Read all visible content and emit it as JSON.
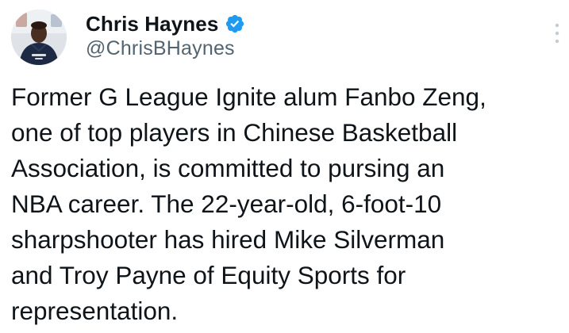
{
  "author": {
    "display_name": "Chris Haynes",
    "handle": "@ChrisBHaynes",
    "verified_icon": "verified-badge-icon",
    "avatar_icon": "profile-avatar"
  },
  "menu": {
    "more_icon": "more-vertical-icon"
  },
  "tweet": {
    "text": "Former G League Ignite alum Fanbo Zeng,\none of top players in Chinese Basketball\nAssociation, is committed to pursing an\nNBA career. The 22-year-old, 6-foot-10\nsharpshooter has hired Mike Silverman\nand Troy Payne of Equity Sports for\nrepresentation."
  },
  "colors": {
    "text": "#0f1419",
    "secondary_text": "#536471",
    "verified_blue": "#1d9bf0",
    "background": "#ffffff"
  }
}
